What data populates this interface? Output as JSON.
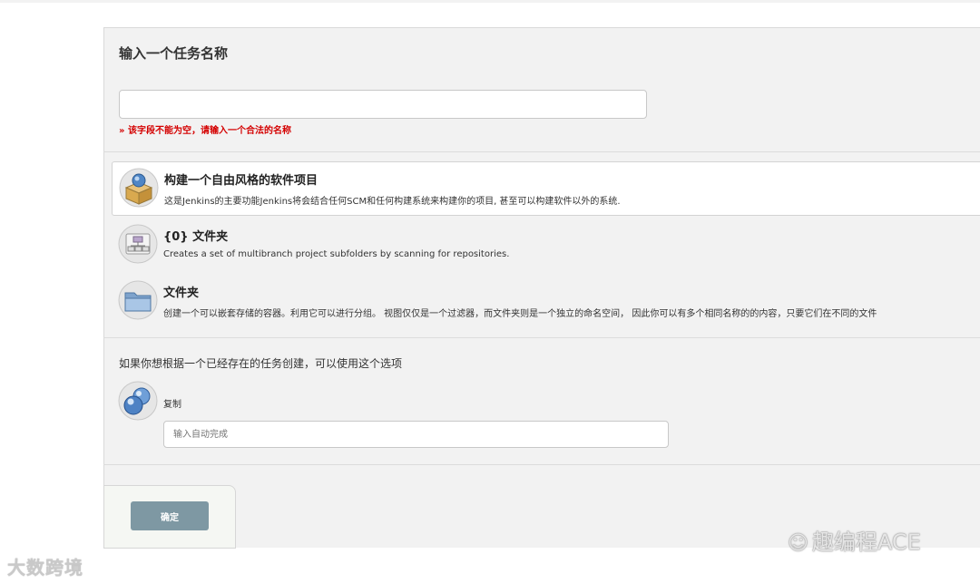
{
  "form": {
    "heading": "输入一个任务名称",
    "name_value": "",
    "error": "» 该字段不能为空，请输入一个合法的名称"
  },
  "job_types": [
    {
      "title": "构建一个自由风格的软件项目",
      "description": "这是Jenkins的主要功能Jenkins将会结合任何SCM和任何构建系统来构建你的项目, 甚至可以构建软件以外的系统.",
      "icon": "freestyle-box-icon",
      "selected": true
    },
    {
      "title": "{0} 文件夹",
      "description": "Creates a set of multibranch project subfolders by scanning for repositories.",
      "icon": "multibranch-folder-icon",
      "selected": false
    },
    {
      "title": "文件夹",
      "description": "创建一个可以嵌套存储的容器。利用它可以进行分组。 视图仅仅是一个过滤器，而文件夹则是一个独立的命名空间， 因此你可以有多个相同名称的的内容，只要它们在不同的文件",
      "icon": "folder-icon",
      "selected": false
    }
  ],
  "copy": {
    "hint": "如果你想根据一个已经存在的任务创建，可以使用这个选项",
    "label": "复制",
    "placeholder": "输入自动完成",
    "icon": "copy-spheres-icon"
  },
  "footer": {
    "ok_label": "确定"
  },
  "watermarks": {
    "left": "大数跨境",
    "right": "趣编程ACE"
  },
  "colors": {
    "error": "#d40000",
    "ok_button": "#7e98a3",
    "panel": "#f2f2f2"
  }
}
